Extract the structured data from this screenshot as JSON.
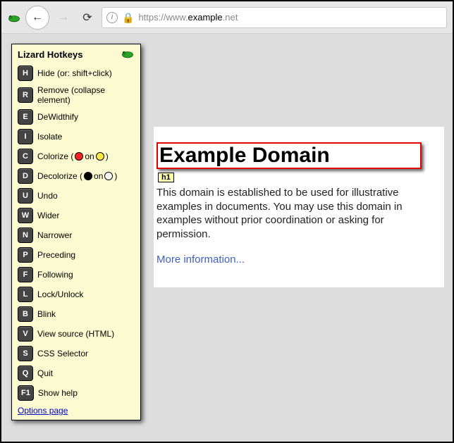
{
  "browser": {
    "url_full": "https://www.example.net",
    "url_host": "example",
    "url_prefix": "https://www.",
    "url_suffix": ".net"
  },
  "panel": {
    "title": "Lizard Hotkeys",
    "options_link": "Options page",
    "items": [
      {
        "key": "H",
        "label": "Hide (or: shift+click)"
      },
      {
        "key": "R",
        "label": "Remove (collapse element)"
      },
      {
        "key": "E",
        "label": "DeWidthify"
      },
      {
        "key": "I",
        "label": "Isolate"
      },
      {
        "key": "C",
        "label_prefix": "Colorize (",
        "label_mid": " on ",
        "label_suffix": ")",
        "sw1": "red",
        "sw2": "yellow"
      },
      {
        "key": "D",
        "label_prefix": "Decolorize (",
        "label_mid": " on ",
        "label_suffix": ")",
        "sw1": "black",
        "sw2": "white"
      },
      {
        "key": "U",
        "label": "Undo"
      },
      {
        "key": "W",
        "label": "Wider"
      },
      {
        "key": "N",
        "label": "Narrower"
      },
      {
        "key": "P",
        "label": "Preceding"
      },
      {
        "key": "F",
        "label": "Following"
      },
      {
        "key": "L",
        "label": "Lock/Unlock"
      },
      {
        "key": "B",
        "label": "Blink"
      },
      {
        "key": "V",
        "label": "View source (HTML)"
      },
      {
        "key": "S",
        "label": "CSS Selector"
      },
      {
        "key": "Q",
        "label": "Quit"
      },
      {
        "key": "F1",
        "label": "Show help"
      }
    ]
  },
  "page": {
    "selected_tag": "h1",
    "heading": "Example Domain",
    "paragraph": "This domain is established to be used for illustrative examples in documents. You may use this domain in examples without prior coordination or asking for permission.",
    "link_text": "More information..."
  }
}
